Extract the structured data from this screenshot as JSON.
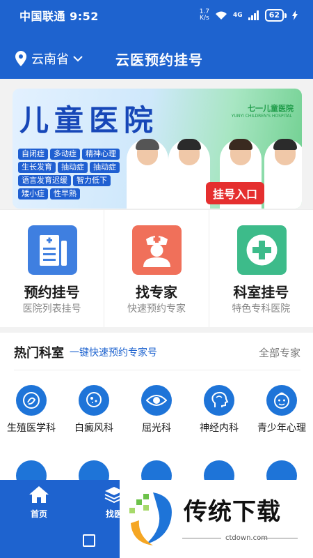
{
  "status_bar": {
    "carrier_time": "中国联通 9:52",
    "net_speed_top": "1.7",
    "net_speed_bottom": "K/s",
    "signal": "4G",
    "battery": "62"
  },
  "header": {
    "location": "云南省",
    "title": "云医预约挂号"
  },
  "banner": {
    "title": "儿童医院",
    "logo_text": "七一儿童医院",
    "logo_sub": "YUNYI CHILDREN'S HOSPITAL",
    "tags": [
      "自闭症",
      "多动症",
      "精神心理",
      "生长发育",
      "抽动症",
      "抽动症",
      "语言发育迟缓",
      "智力低下",
      "矮小症",
      "性早熟"
    ],
    "cta": "挂号入口"
  },
  "quick_entries": [
    {
      "title": "预约挂号",
      "subtitle": "医院列表挂号",
      "icon": "hospital-list-icon",
      "color": "#3f7fe0"
    },
    {
      "title": "找专家",
      "subtitle": "快速预约专家",
      "icon": "doctor-icon",
      "color": "#f0705a"
    },
    {
      "title": "科室挂号",
      "subtitle": "特色专科医院",
      "icon": "plus-cross-icon",
      "color": "#3dbb8a"
    }
  ],
  "hot_departments": {
    "title": "热门科室",
    "subtitle": "一键快速预约专家号",
    "all_link": "全部专家",
    "row1": [
      {
        "label": "生殖医学科",
        "icon": "fetus-icon"
      },
      {
        "label": "白癜风科",
        "icon": "skin-patch-icon"
      },
      {
        "label": "屈光科",
        "icon": "eye-icon"
      },
      {
        "label": "神经内科",
        "icon": "brain-head-icon"
      },
      {
        "label": "青少年心理",
        "icon": "child-face-icon"
      }
    ]
  },
  "bottom_nav": {
    "home": "首页",
    "second": "找医"
  },
  "watermark": {
    "title": "传统下载",
    "url": "ctdown.com"
  },
  "colors": {
    "primary": "#1e63cf",
    "accent_red": "#e52f2f"
  }
}
